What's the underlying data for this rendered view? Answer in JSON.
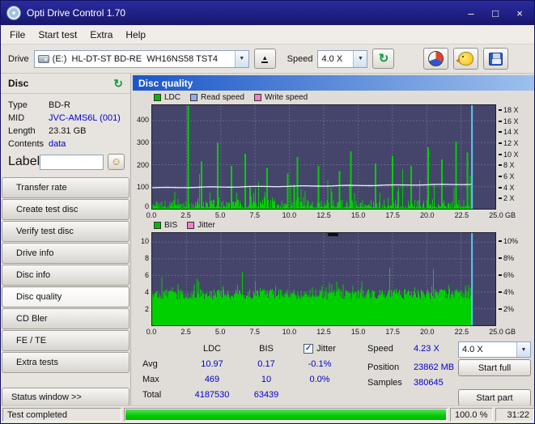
{
  "window": {
    "title": "Opti Drive Control 1.70",
    "minimize_glyph": "–",
    "maximize_glyph": "□",
    "close_glyph": "×"
  },
  "icons": {
    "combo_arrow": "▼",
    "check": "✓"
  },
  "menu": [
    "File",
    "Start test",
    "Extra",
    "Help"
  ],
  "toolbar": {
    "drive_label": "Drive",
    "drive_value": "(E:)  HL-DT-ST BD-RE  WH16NS58 TST4",
    "eject_icon": "▲",
    "speed_label": "Speed",
    "speed_value": "4.0 X",
    "refresh_icon": "↻"
  },
  "sidebar": {
    "panel_title": "Disc",
    "refresh_icon": "↻",
    "fields": [
      {
        "label": "Type",
        "value": "BD-R",
        "blue": false,
        "link": false
      },
      {
        "label": "MID",
        "value": "JVC-AMS6L (001)",
        "blue": true,
        "link": false
      },
      {
        "label": "Length",
        "value": "23.31 GB",
        "blue": false,
        "link": false
      },
      {
        "label": "Contents",
        "value": "data",
        "blue": true,
        "link": true
      }
    ],
    "label_label": "Label",
    "label_value": "",
    "smiley_icon": "☺",
    "buttons": [
      "Transfer rate",
      "Create test disc",
      "Verify test disc",
      "Drive info",
      "Disc info",
      "Disc quality",
      "CD Bler",
      "FE / TE",
      "Extra tests"
    ],
    "active_button": "Disc quality",
    "status_button": "Status window >>"
  },
  "main": {
    "title": "Disc quality",
    "legend_top": [
      {
        "label": "LDC",
        "color": "#00bb00"
      },
      {
        "label": "Read speed",
        "color": "#8fb0f0"
      },
      {
        "label": "Write speed",
        "color": "#f080c8"
      }
    ],
    "legend_bottom": [
      {
        "label": "BIS",
        "color": "#00bb00"
      },
      {
        "label": "Jitter",
        "color": "#f080c8"
      }
    ]
  },
  "stats": {
    "columns": [
      "LDC",
      "BIS"
    ],
    "jitter_label": "Jitter",
    "jitter_checked": true,
    "rows": [
      {
        "label": "Avg",
        "ldc": "10.97",
        "bis": "0.17",
        "jitter": "-0.1%"
      },
      {
        "label": "Max",
        "ldc": "469",
        "bis": "10",
        "jitter": "0.0%"
      },
      {
        "label": "Total",
        "ldc": "4187530",
        "bis": "63439",
        "jitter": ""
      }
    ],
    "speed_label": "Speed",
    "speed_value": "4.23 X",
    "speed_combo": "4.0 X",
    "position_label": "Position",
    "position_value": "23862 MB",
    "samples_label": "Samples",
    "samples_value": "380645",
    "start_full": "Start full",
    "start_part": "Start part"
  },
  "statusbar": {
    "text": "Test completed",
    "progress_percent": 100,
    "progress_label": "100.0 %",
    "time": "31:22"
  },
  "chart_data": [
    {
      "type": "bar",
      "name": "LDC errors vs disc position with read speed overlay",
      "x_unit": "GB",
      "x_ticks": [
        "0.0",
        "2.5",
        "5.0",
        "7.5",
        "10.0",
        "12.5",
        "15.0",
        "17.5",
        "20.0",
        "22.5",
        "25.0"
      ],
      "x_max_gb": 25.0,
      "data_end_gb": 23.31,
      "left_axis_ticks": [
        "400",
        "300",
        "200",
        "100",
        "0"
      ],
      "left_axis_max": 470,
      "right_axis_ticks": [
        "18 X",
        "16 X",
        "14 X",
        "12 X",
        "10 X",
        "8 X",
        "6 X",
        "4 X",
        "2 X"
      ],
      "right_axis_max": 19,
      "end_marker_color": "#5ac8f5",
      "series": [
        {
          "name": "LDC",
          "color": "#00d000",
          "avg": 10.97,
          "max": 469,
          "total": 4187530
        },
        {
          "name": "Read speed",
          "color": "#edf1ff",
          "start_speed_x": 3.85,
          "end_speed_x": 4.5,
          "avg_speed_x": 4.23
        }
      ],
      "gen": {
        "seed": 1337,
        "base": 40,
        "minor_spike_prob": 0.1,
        "minor_spike_amp": 85,
        "mid_spike_prob": 0.03,
        "mid_spike_amp": 170,
        "forced_spikes": [
          [
            0.112,
            469
          ],
          [
            0.155,
            215
          ],
          [
            0.205,
            300
          ],
          [
            0.248,
            195
          ],
          [
            0.29,
            250
          ],
          [
            0.36,
            185
          ],
          [
            0.425,
            160
          ],
          [
            0.455,
            235
          ],
          [
            0.52,
            195
          ],
          [
            0.585,
            170
          ],
          [
            0.62,
            260
          ],
          [
            0.7,
            205
          ],
          [
            0.752,
            240
          ],
          [
            0.81,
            195
          ],
          [
            0.862,
            280
          ],
          [
            0.905,
            225
          ],
          [
            0.952,
            305
          ],
          [
            0.985,
            255
          ]
        ]
      }
    },
    {
      "type": "bar",
      "name": "BIS errors vs disc position with jitter axis",
      "x_unit": "GB",
      "x_ticks": [
        "0.0",
        "2.5",
        "5.0",
        "7.5",
        "10.0",
        "12.5",
        "15.0",
        "17.5",
        "20.0",
        "22.5",
        "25.0"
      ],
      "x_max_gb": 25.0,
      "data_end_gb": 23.31,
      "left_axis_ticks": [
        "10",
        "8",
        "6",
        "4",
        "2"
      ],
      "right_axis_ticks": [
        "10%",
        "8%",
        "6%",
        "4%",
        "2%"
      ],
      "axis_max": 11.1,
      "end_marker_color": "#5ac8f5",
      "series": [
        {
          "name": "BIS",
          "color": "#00d000",
          "avg": 0.17,
          "max": 10,
          "total": 63439
        },
        {
          "name": "Jitter",
          "color": "#f080c8",
          "avg": "-0.1%",
          "max": "0.0%"
        }
      ],
      "gen": {
        "seed": 4242,
        "base": 3.1,
        "noise": 1.3,
        "minor_spike_prob": 0.12,
        "minor_spike_amp": 1.2,
        "mid_spike_prob": 0.025,
        "mid_spike_amp": 2.3
      }
    }
  ]
}
